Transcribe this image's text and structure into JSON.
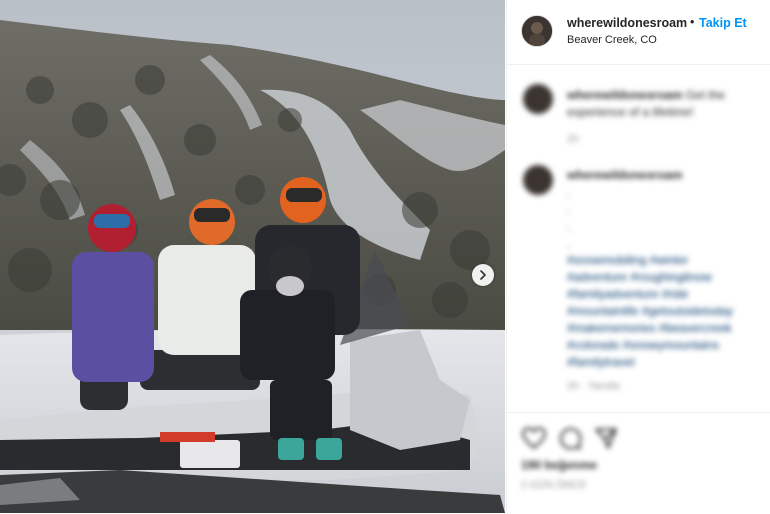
{
  "post": {
    "username": "wherewildonesroam",
    "separator": "•",
    "follow_label": "Takip Et",
    "location": "Beaver Creek, CO"
  },
  "comments": [
    {
      "username": "wherewildonesroam",
      "text": "Get the experience of a lifetime!",
      "meta": "2h"
    },
    {
      "username": "wherewildonesroam",
      "lines": [
        ".",
        ".",
        ".",
        "."
      ],
      "hashtags": [
        "#snowmobiling #winter",
        "#adventure #roughingitnow",
        "#familyadventure #ride",
        "#mountainlife #getoutsidetoday",
        "#makememories #beavercreek",
        "#colorado #snowymountains",
        "#familytravel"
      ],
      "meta": "2h · Yanıtla"
    }
  ],
  "actions": {
    "icons": [
      "heart-icon",
      "comment-icon",
      "share-icon"
    ],
    "likes": "190 beğenme",
    "timestamp": "2 GÜN ÖNCE"
  },
  "colors": {
    "accent": "#0095f6",
    "text": "#262626",
    "hashtag": "#00376b"
  }
}
